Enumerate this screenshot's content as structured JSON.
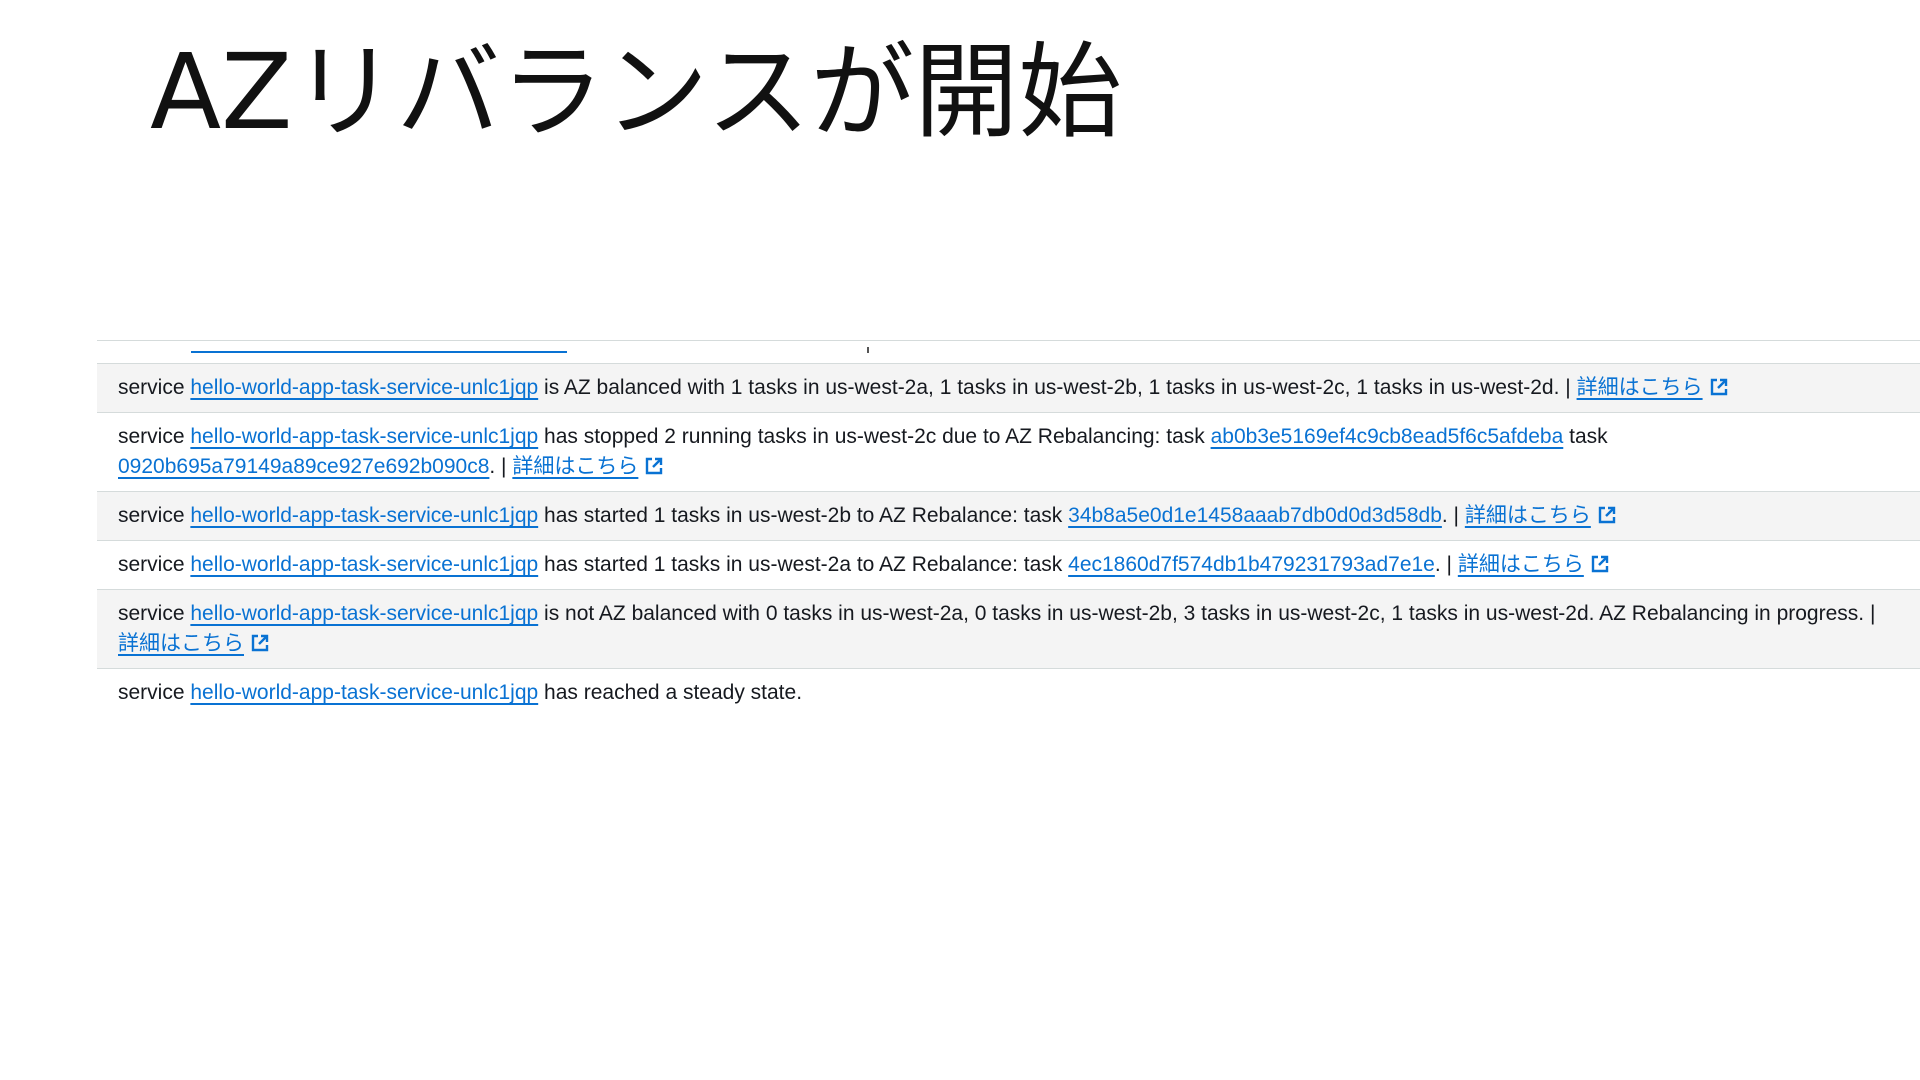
{
  "slide": {
    "title": "AZリバランスが開始"
  },
  "log": {
    "service_word": "service",
    "details_label": "詳細はこちら",
    "entries": [
      {
        "service_name": "hello-world-app-task-service-unlc1jqp",
        "text1": "is AZ balanced with 1 tasks in us-west-2a, 1 tasks in us-west-2b, 1 tasks in us-west-2c, 1 tasks in us-west-2d. |"
      },
      {
        "service_name": "hello-world-app-task-service-unlc1jqp",
        "text1": "has stopped 2 running tasks in us-west-2c due to AZ Rebalancing: task",
        "task1": "ab0b3e5169ef4c9cb8ead5f6c5afdeba",
        "text2": "task",
        "task2": "0920b695a79149a89ce927e692b090c8",
        "text3": ". |"
      },
      {
        "service_name": "hello-world-app-task-service-unlc1jqp",
        "text1": "has started 1 tasks in us-west-2b to AZ Rebalance: task",
        "task1": "34b8a5e0d1e1458aaab7db0d0d3d58db",
        "text2": ". |"
      },
      {
        "service_name": "hello-world-app-task-service-unlc1jqp",
        "text1": "has started 1 tasks in us-west-2a to AZ Rebalance: task",
        "task1": "4ec1860d7f574db1b479231793ad7e1e",
        "text2": ". |"
      },
      {
        "service_name": "hello-world-app-task-service-unlc1jqp",
        "text1": "is not AZ balanced with 0 tasks in us-west-2a, 0 tasks in us-west-2b, 3 tasks in us-west-2c, 1 tasks in us-west-2d. AZ Rebalancing in progress. |"
      },
      {
        "service_name": "hello-world-app-task-service-unlc1jqp",
        "text1": "has reached a steady state."
      }
    ]
  },
  "colors": {
    "link": "#0972d3",
    "row_alt": "#f4f4f4",
    "border": "#d5dbdb",
    "text": "#16191f"
  },
  "icons": {
    "external": "external-link-icon"
  }
}
